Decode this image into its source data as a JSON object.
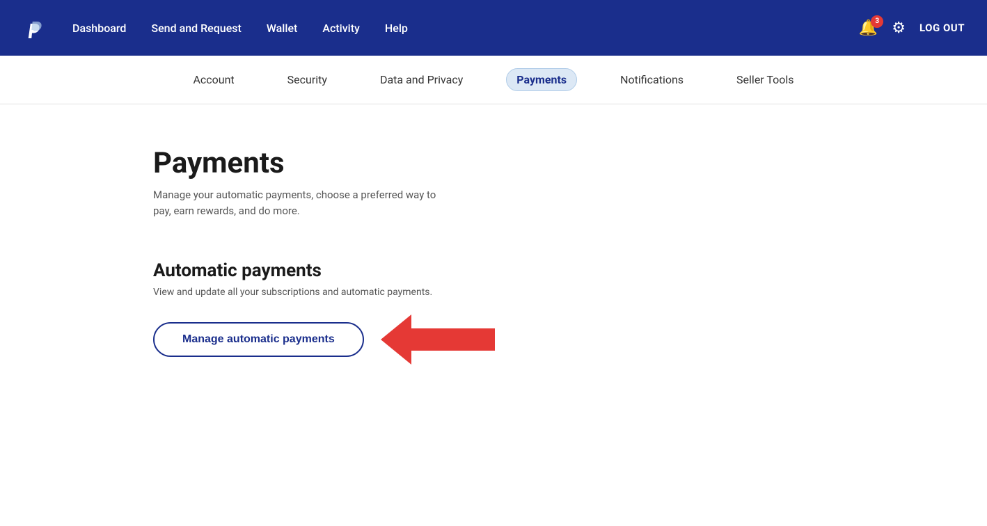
{
  "topNav": {
    "logo_alt": "PayPal",
    "links": [
      {
        "label": "Dashboard",
        "name": "dashboard"
      },
      {
        "label": "Send and Request",
        "name": "send-and-request"
      },
      {
        "label": "Wallet",
        "name": "wallet"
      },
      {
        "label": "Activity",
        "name": "activity"
      },
      {
        "label": "Help",
        "name": "help"
      }
    ],
    "bell_count": "3",
    "logout_label": "LOG OUT"
  },
  "subNav": {
    "items": [
      {
        "label": "Account",
        "name": "account",
        "active": false
      },
      {
        "label": "Security",
        "name": "security",
        "active": false
      },
      {
        "label": "Data and Privacy",
        "name": "data-and-privacy",
        "active": false
      },
      {
        "label": "Payments",
        "name": "payments",
        "active": true
      },
      {
        "label": "Notifications",
        "name": "notifications",
        "active": false
      },
      {
        "label": "Seller Tools",
        "name": "seller-tools",
        "active": false
      }
    ]
  },
  "mainContent": {
    "page_title": "Payments",
    "page_subtitle": "Manage your automatic payments, choose a preferred way to pay, earn rewards, and do more.",
    "section_title": "Automatic payments",
    "section_subtitle": "View and update all your subscriptions and automatic payments.",
    "manage_btn_label": "Manage automatic payments"
  }
}
